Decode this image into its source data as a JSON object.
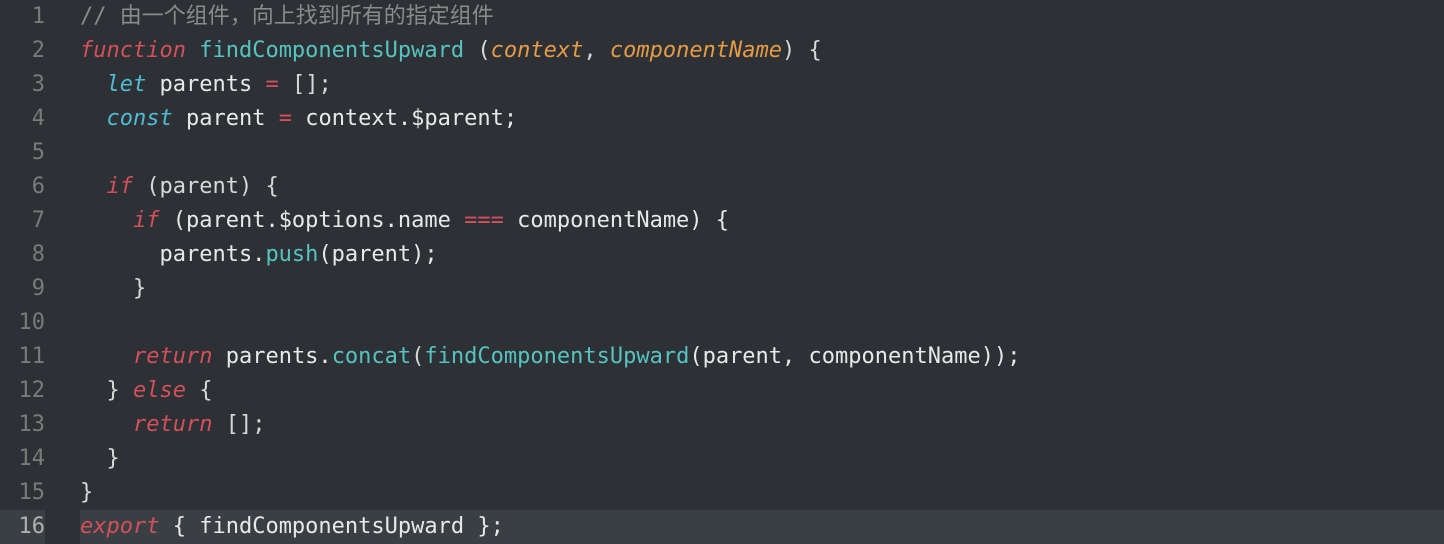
{
  "editor": {
    "currentLine": 16,
    "lines": [
      {
        "num": 1,
        "tokens": [
          {
            "t": "// 由一个组件，向上找到所有的指定组件",
            "c": "c-comment"
          }
        ]
      },
      {
        "num": 2,
        "tokens": [
          {
            "t": "function",
            "c": "c-storage"
          },
          {
            "t": " ",
            "c": "c-plain"
          },
          {
            "t": "findComponentsUpward",
            "c": "c-fn"
          },
          {
            "t": " ",
            "c": "c-plain"
          },
          {
            "t": "(",
            "c": "c-punc"
          },
          {
            "t": "context",
            "c": "c-param"
          },
          {
            "t": ", ",
            "c": "c-punc"
          },
          {
            "t": "componentName",
            "c": "c-param"
          },
          {
            "t": ")",
            "c": "c-punc"
          },
          {
            "t": " ",
            "c": "c-plain"
          },
          {
            "t": "{",
            "c": "c-punc"
          }
        ]
      },
      {
        "num": 3,
        "tokens": [
          {
            "t": "  ",
            "c": "c-plain"
          },
          {
            "t": "let",
            "c": "c-let"
          },
          {
            "t": " parents ",
            "c": "c-plain"
          },
          {
            "t": "=",
            "c": "c-op"
          },
          {
            "t": " [];",
            "c": "c-punc"
          }
        ]
      },
      {
        "num": 4,
        "tokens": [
          {
            "t": "  ",
            "c": "c-plain"
          },
          {
            "t": "const",
            "c": "c-const"
          },
          {
            "t": " parent ",
            "c": "c-plain"
          },
          {
            "t": "=",
            "c": "c-op"
          },
          {
            "t": " context.$parent;",
            "c": "c-plain"
          }
        ]
      },
      {
        "num": 5,
        "tokens": [
          {
            "t": "",
            "c": "c-plain"
          }
        ]
      },
      {
        "num": 6,
        "tokens": [
          {
            "t": "  ",
            "c": "c-plain"
          },
          {
            "t": "if",
            "c": "c-keyword"
          },
          {
            "t": " (parent) {",
            "c": "c-punc"
          }
        ]
      },
      {
        "num": 7,
        "tokens": [
          {
            "t": "    ",
            "c": "c-plain"
          },
          {
            "t": "if",
            "c": "c-keyword"
          },
          {
            "t": " (parent.$options.name ",
            "c": "c-plain"
          },
          {
            "t": "===",
            "c": "c-op"
          },
          {
            "t": " componentName) {",
            "c": "c-plain"
          }
        ]
      },
      {
        "num": 8,
        "tokens": [
          {
            "t": "      parents.",
            "c": "c-plain"
          },
          {
            "t": "push",
            "c": "c-method"
          },
          {
            "t": "(parent);",
            "c": "c-plain"
          }
        ]
      },
      {
        "num": 9,
        "tokens": [
          {
            "t": "    }",
            "c": "c-punc"
          }
        ]
      },
      {
        "num": 10,
        "tokens": [
          {
            "t": "",
            "c": "c-plain"
          }
        ]
      },
      {
        "num": 11,
        "tokens": [
          {
            "t": "    ",
            "c": "c-plain"
          },
          {
            "t": "return",
            "c": "c-keyword"
          },
          {
            "t": " parents.",
            "c": "c-plain"
          },
          {
            "t": "concat",
            "c": "c-method"
          },
          {
            "t": "(",
            "c": "c-punc"
          },
          {
            "t": "findComponentsUpward",
            "c": "c-fn"
          },
          {
            "t": "(parent, componentName));",
            "c": "c-plain"
          }
        ]
      },
      {
        "num": 12,
        "tokens": [
          {
            "t": "  } ",
            "c": "c-punc"
          },
          {
            "t": "else",
            "c": "c-keyword"
          },
          {
            "t": " {",
            "c": "c-punc"
          }
        ]
      },
      {
        "num": 13,
        "tokens": [
          {
            "t": "    ",
            "c": "c-plain"
          },
          {
            "t": "return",
            "c": "c-keyword"
          },
          {
            "t": " [];",
            "c": "c-punc"
          }
        ]
      },
      {
        "num": 14,
        "tokens": [
          {
            "t": "  }",
            "c": "c-punc"
          }
        ]
      },
      {
        "num": 15,
        "tokens": [
          {
            "t": "}",
            "c": "c-punc"
          }
        ]
      },
      {
        "num": 16,
        "tokens": [
          {
            "t": "export",
            "c": "c-keyword"
          },
          {
            "t": " { findComponentsUpward };",
            "c": "c-plain"
          }
        ]
      }
    ]
  }
}
